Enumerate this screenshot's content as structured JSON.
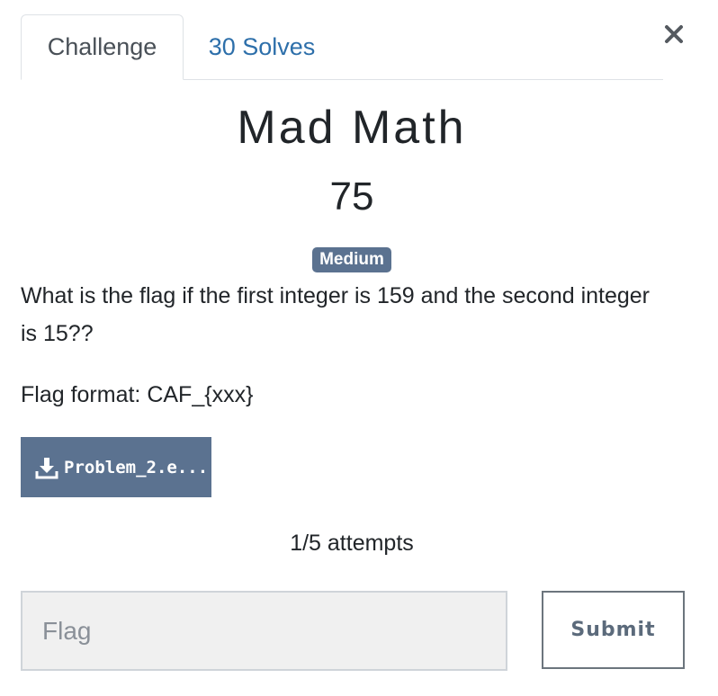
{
  "tabs": [
    {
      "label": "Challenge",
      "active": true
    },
    {
      "label": "30 Solves",
      "active": false
    }
  ],
  "close_icon": "close-icon",
  "challenge": {
    "name": "Mad Math",
    "points": "75",
    "difficulty": "Medium",
    "description": "What is the flag if the first integer is 159 and the second integer is 15??",
    "flag_format": "Flag format: CAF_{xxx}"
  },
  "file": {
    "icon": "download-icon",
    "label": "Problem_2.e..."
  },
  "attempts": "1/5 attempts",
  "form": {
    "flag_placeholder": "Flag",
    "flag_value": "",
    "submit_label": "Submit"
  },
  "colors": {
    "accent": "#5b7290",
    "link": "#2d6faa",
    "input_bg": "#f0f0f0"
  }
}
